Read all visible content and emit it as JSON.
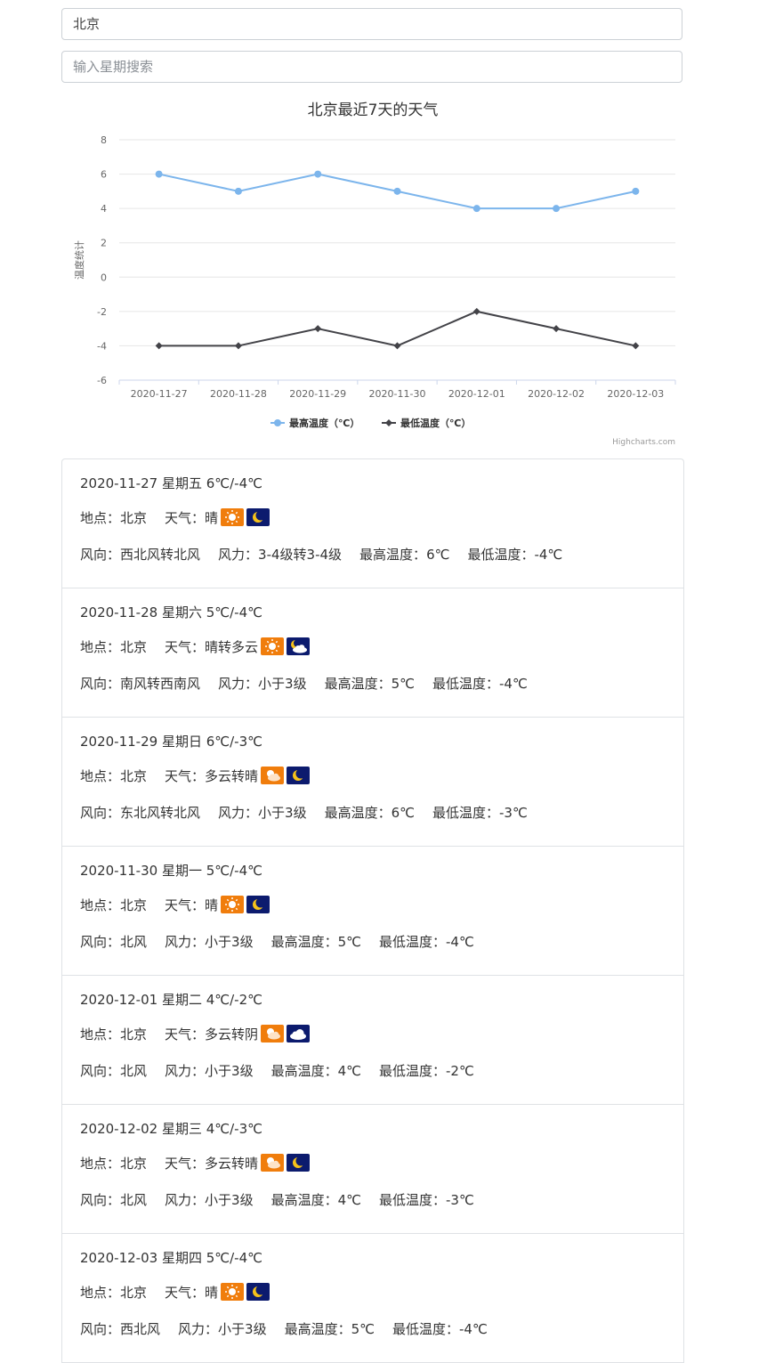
{
  "search": {
    "city_value": "北京",
    "weekday_placeholder": "输入星期搜索"
  },
  "chart_data": {
    "type": "line",
    "title": "北京最近7天的天气",
    "ylabel": "温度统计",
    "xlabel": "",
    "categories": [
      "2020-11-27",
      "2020-11-28",
      "2020-11-29",
      "2020-11-30",
      "2020-12-01",
      "2020-12-02",
      "2020-12-03"
    ],
    "ylim": [
      -6,
      8
    ],
    "yticks": [
      8,
      6,
      4,
      2,
      0,
      -2,
      -4,
      -6
    ],
    "series": [
      {
        "name": "最高温度（℃）",
        "values": [
          6,
          5,
          6,
          5,
          4,
          4,
          5
        ],
        "color": "#7cb5ec",
        "marker": "circle"
      },
      {
        "name": "最低温度（℃）",
        "values": [
          -4,
          -4,
          -3,
          -4,
          -2,
          -3,
          -4
        ],
        "color": "#434348",
        "marker": "diamond"
      }
    ],
    "legend": "bottom-center",
    "grid": true,
    "credits": "Highcharts.com"
  },
  "labels": {
    "location": "地点：",
    "weather": "天气：",
    "wind_dir": "风向：",
    "wind_force": "风力：",
    "high": "最高温度：",
    "low": "最低温度："
  },
  "days": [
    {
      "header": "2020-11-27 星期五 6℃/-4℃",
      "location": "北京",
      "weather": "晴",
      "day_icon": "sun-icon",
      "night_icon": "moon-icon",
      "wind_dir": "西北风转北风",
      "wind_force": "3-4级转3-4级",
      "high": "6℃",
      "low": "-4℃"
    },
    {
      "header": "2020-11-28 星期六 5℃/-4℃",
      "location": "北京",
      "weather": "晴转多云",
      "day_icon": "sun-icon",
      "night_icon": "moon-cloud-icon",
      "wind_dir": "南风转西南风",
      "wind_force": "小于3级",
      "high": "5℃",
      "low": "-4℃"
    },
    {
      "header": "2020-11-29 星期日 6℃/-3℃",
      "location": "北京",
      "weather": "多云转晴",
      "day_icon": "sun-cloud-icon",
      "night_icon": "moon-icon",
      "wind_dir": "东北风转北风",
      "wind_force": "小于3级",
      "high": "6℃",
      "low": "-3℃"
    },
    {
      "header": "2020-11-30 星期一 5℃/-4℃",
      "location": "北京",
      "weather": "晴",
      "day_icon": "sun-icon",
      "night_icon": "moon-icon",
      "wind_dir": "北风",
      "wind_force": "小于3级",
      "high": "5℃",
      "low": "-4℃"
    },
    {
      "header": "2020-12-01 星期二 4℃/-2℃",
      "location": "北京",
      "weather": "多云转阴",
      "day_icon": "sun-cloud-icon",
      "night_icon": "cloud-icon",
      "wind_dir": "北风",
      "wind_force": "小于3级",
      "high": "4℃",
      "low": "-2℃"
    },
    {
      "header": "2020-12-02 星期三 4℃/-3℃",
      "location": "北京",
      "weather": "多云转晴",
      "day_icon": "sun-cloud-icon",
      "night_icon": "moon-icon",
      "wind_dir": "北风",
      "wind_force": "小于3级",
      "high": "4℃",
      "low": "-3℃"
    },
    {
      "header": "2020-12-03 星期四 5℃/-4℃",
      "location": "北京",
      "weather": "晴",
      "day_icon": "sun-icon",
      "night_icon": "moon-icon",
      "wind_dir": "西北风",
      "wind_force": "小于3级",
      "high": "5℃",
      "low": "-4℃"
    }
  ]
}
